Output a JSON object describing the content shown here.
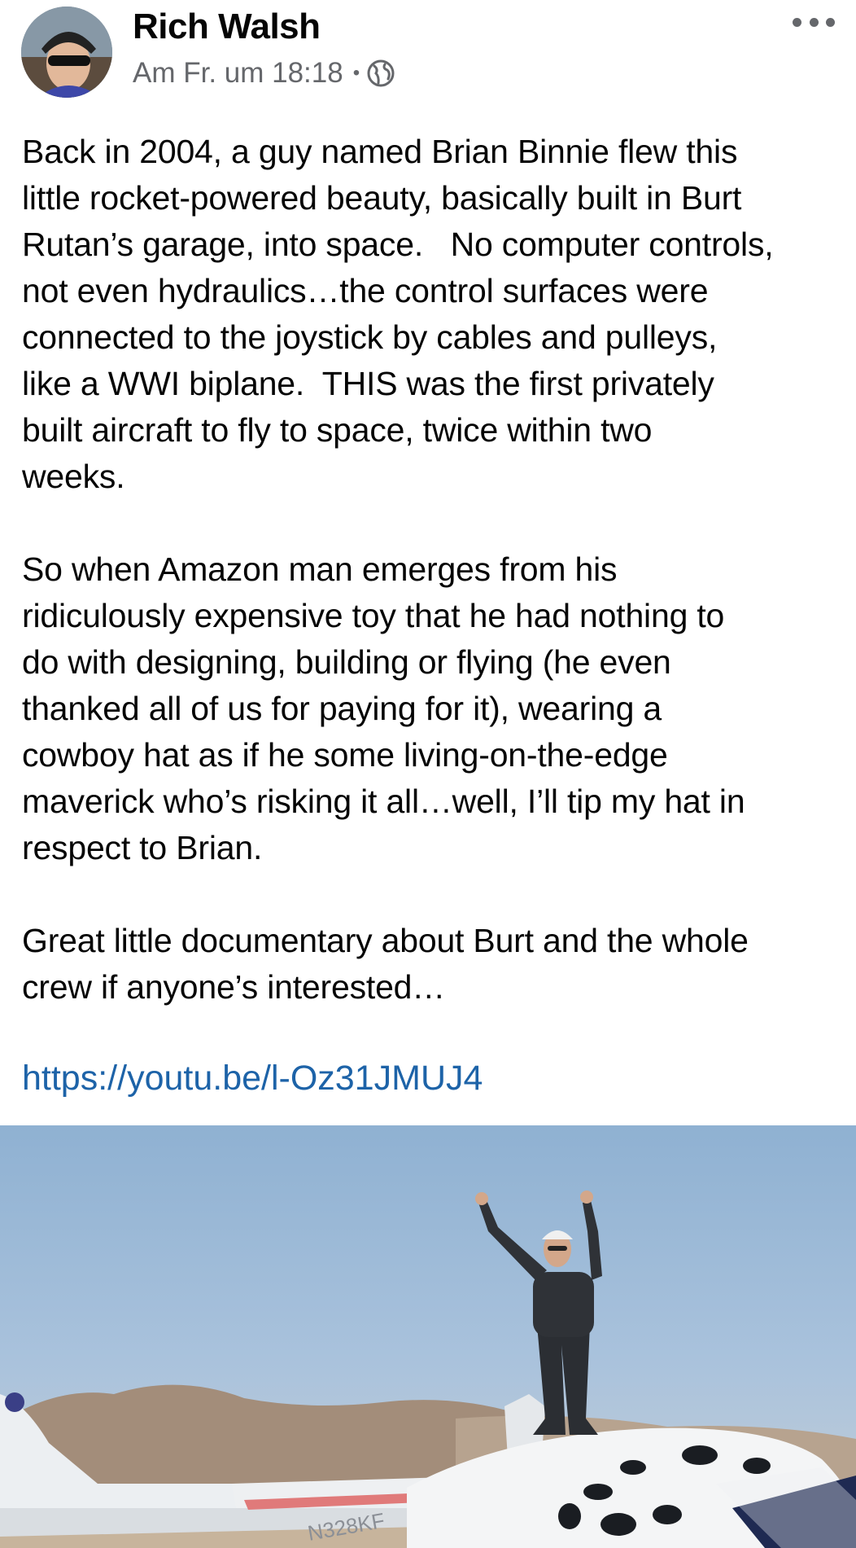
{
  "post": {
    "author": "Rich Walsh",
    "timestamp": "Am Fr. um 18:18",
    "separator": "•",
    "privacy_icon": "globe-icon",
    "menu_icon": "more-options-icon",
    "text": "Back in 2004, a guy named Brian Binnie flew this\nlittle rocket-powered beauty, basically built in Burt\nRutan’s garage, into space.   No computer controls,\nnot even hydraulics…the control surfaces were\nconnected to the joystick by cables and pulleys,\nlike a WWI biplane.  THIS was the first privately\nbuilt aircraft to fly to space, twice within two\nweeks.\n\nSo when Amazon man emerges from his\nridiculously expensive toy that he had nothing to\ndo with designing, building or flying (he even\nthanked all of us for paying for it), wearing a\ncowboy hat as if he some living-on-the-edge\nmaverick who’s risking it all…well, I’ll tip my hat in\nrespect to Brian.\n\nGreat little documentary about Burt and the whole\ncrew if anyone’s interested…",
    "link": "https://youtu.be/l-Oz31JMUJ4"
  },
  "colors": {
    "link": "#1d63a8",
    "secondary_text": "#65676b",
    "sky": "#9db9d6"
  },
  "image": {
    "aircraft_marking": "N328KF"
  }
}
